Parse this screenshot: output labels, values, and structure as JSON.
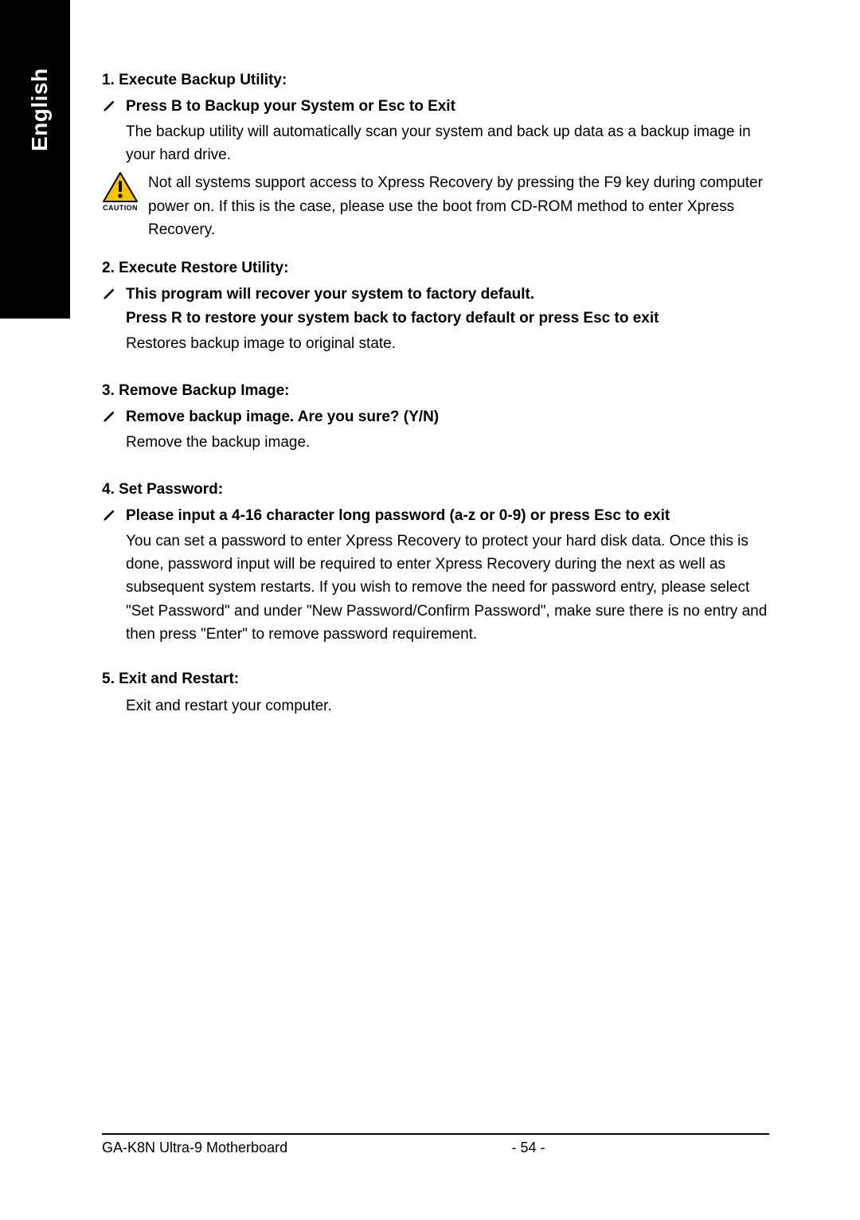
{
  "lang_tab": "English",
  "sections": {
    "s1": {
      "heading": "1. Execute Backup Utility:",
      "sub": "Press B to Backup your System or Esc to Exit",
      "body": "The backup utility will automatically scan your system and back up data as a backup image in your hard drive.",
      "caution_label": "CAUTION",
      "caution_text": "Not all systems support access to Xpress Recovery by pressing the F9 key during computer power on. If this is the case, please use the boot from CD-ROM method to enter Xpress Recovery."
    },
    "s2": {
      "heading": "2. Execute Restore Utility:",
      "sub1": "This program will recover your system to factory default.",
      "sub2": "Press R to restore your system back to factory default or press Esc to exit",
      "body": "Restores backup image to original state."
    },
    "s3": {
      "heading": "3. Remove Backup Image:",
      "sub": "Remove backup image.  Are you sure?  (Y/N)",
      "body": "Remove the backup image."
    },
    "s4": {
      "heading": "4. Set Password:",
      "sub": "Please input a 4-16 character long password (a-z or 0-9) or press Esc to exit",
      "body": "You can set a password to enter Xpress Recovery to protect your hard disk data.  Once this is done, password input will be required to enter Xpress Recovery during the next as well as subsequent system restarts.  If you wish to remove the need for password entry, please select \"Set Password\" and under \"New Password/Confirm Password\", make sure there is no entry and then press \"Enter\" to remove password requirement."
    },
    "s5": {
      "heading": "5. Exit and Restart:",
      "body": "Exit and restart your computer."
    }
  },
  "footer": {
    "product": "GA-K8N Ultra-9 Motherboard",
    "page": "- 54 -"
  }
}
